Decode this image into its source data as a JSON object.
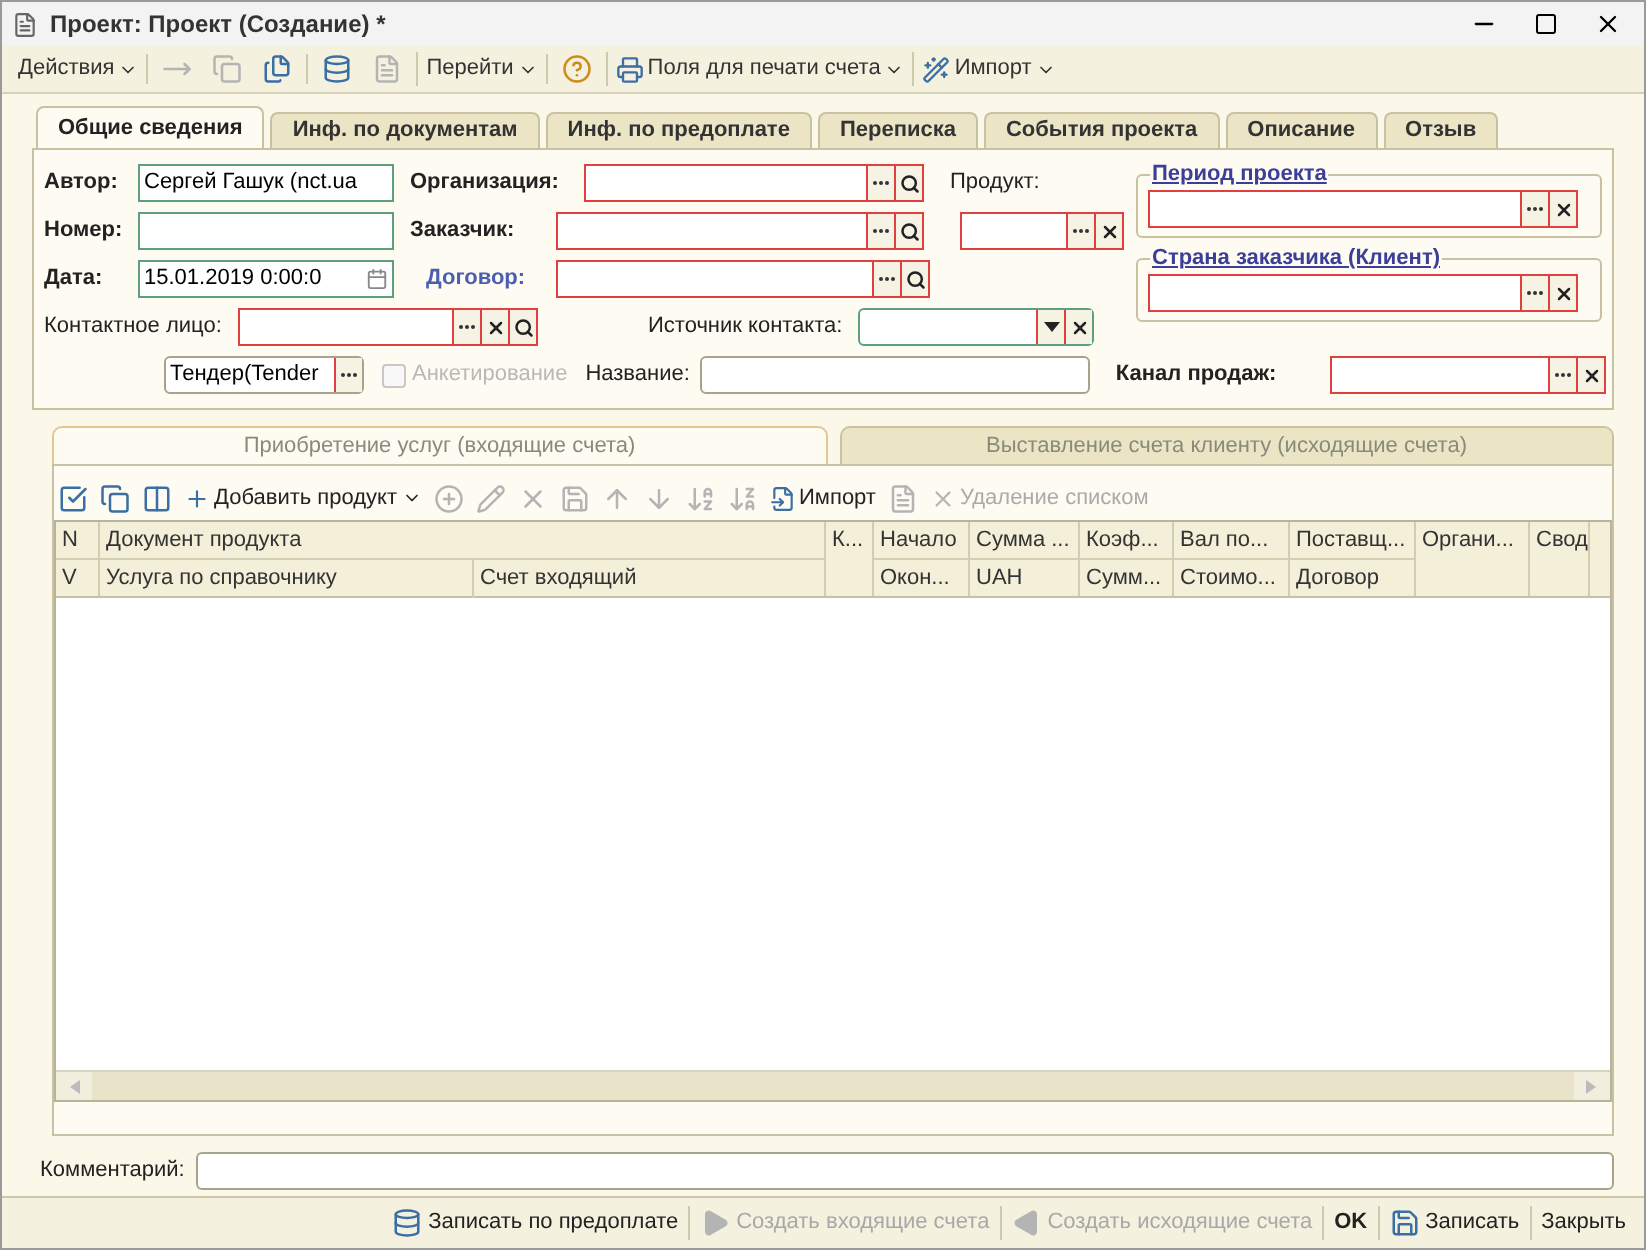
{
  "window": {
    "title": "Проект: Проект (Создание) *"
  },
  "toolbar": [
    [
      {
        "kind": "menu",
        "label": "Действия"
      }
    ],
    [
      {
        "kind": "icon",
        "disabled": true
      },
      {
        "kind": "icon",
        "disabled": true
      },
      {
        "kind": "icon",
        "disabled": false
      }
    ],
    [
      {
        "kind": "icon",
        "disabled": false
      },
      {
        "kind": "icon",
        "disabled": true
      }
    ],
    [
      {
        "kind": "menu",
        "label": "Перейти"
      }
    ],
    [
      {
        "kind": "icon",
        "disabled": false
      }
    ],
    [
      {
        "kind": "menu",
        "label": "Поля для печати счета"
      }
    ],
    [
      {
        "kind": "menu",
        "label": "Импорт"
      }
    ]
  ],
  "tabs": [
    {
      "label": "Общие сведения",
      "selected": true
    },
    {
      "label": "Инф. по документам",
      "selected": false
    },
    {
      "label": "Инф. по предоплате",
      "selected": false
    },
    {
      "label": "Переписка",
      "selected": false
    },
    {
      "label": "События проекта",
      "selected": false
    },
    {
      "label": "Описание",
      "selected": false
    },
    {
      "label": "Отзыв",
      "selected": false
    }
  ],
  "form": {
    "author": {
      "label": "Автор:",
      "value": "Сергей Гашук (nct.ua",
      "required": false
    },
    "number": {
      "label": "Номер:",
      "required": false
    },
    "date": {
      "label": "Дата:",
      "value": "15.01.2019  0:00:0",
      "required": false
    },
    "organization": {
      "label": "Организация:",
      "required": true
    },
    "customer": {
      "label": "Заказчик:",
      "required": true
    },
    "contract": {
      "label": "Договор:",
      "required": true
    },
    "product": {
      "label": "Продукт:",
      "required": true
    },
    "contact_person": {
      "label": "Контактное лицо:",
      "required": true
    },
    "contact_source": {
      "label": "Источник контакта:",
      "required": false
    },
    "tender": {
      "value": "Тендер(Tender"
    },
    "questionnaire": {
      "label": "Анкетирование",
      "checked": false,
      "disabled": true
    },
    "name": {
      "label": "Название:"
    },
    "sales_channel": {
      "label": "Канал продаж:",
      "required": true
    },
    "project_period": {
      "label": "Период проекта",
      "required": true
    },
    "customer_country": {
      "label": "Страна заказчика (Клиент)",
      "required": true
    }
  },
  "subtabs": [
    {
      "label": "Приобретение услуг (входящие счета)",
      "selected": true
    },
    {
      "label": "Выставление счета клиенту (исходящие счета)",
      "selected": false
    }
  ],
  "table_toolbar": [
    {
      "disabled": false
    },
    {
      "disabled": false
    },
    {
      "disabled": false
    },
    {
      "label": "Добавить продукт",
      "menu": true,
      "disabled": false
    },
    {
      "disabled": true
    },
    {
      "disabled": true
    },
    {
      "disabled": true
    },
    {
      "disabled": true
    },
    {
      "disabled": true
    },
    {
      "disabled": true
    },
    {
      "disabled": true
    },
    {
      "disabled": true
    },
    {
      "label": "Импорт",
      "disabled": false
    },
    {
      "disabled": true
    },
    {
      "label": "Удаление списком",
      "disabled": true
    }
  ],
  "table": {
    "columns": [
      {
        "top": "N",
        "bottom": "V"
      },
      {
        "top": "Документ продукта",
        "bottom_parts": [
          "Услуга по справочнику",
          "Счет входящий"
        ]
      },
      {
        "top": "К..."
      },
      {
        "top": "Начало",
        "bottom": "Окон..."
      },
      {
        "top": "Сумма ...",
        "bottom": "UAH"
      },
      {
        "top": "Коэф...",
        "bottom": "Сумм..."
      },
      {
        "top": "Вал по...",
        "bottom": "Стоимо..."
      },
      {
        "top": "Поставщ...",
        "bottom": "Договор"
      },
      {
        "top": "Органи..."
      },
      {
        "top": "Свод"
      }
    ]
  },
  "comment": {
    "label": "Комментарий:"
  },
  "bottom_buttons": [
    {
      "label": "Записать по предоплате",
      "disabled": false
    },
    {
      "label": "Создать входящие счета",
      "disabled": true
    },
    {
      "label": "Создать исходящие счета",
      "disabled": true
    },
    {
      "label": "OK",
      "bold": true,
      "disabled": false
    },
    {
      "label": "Записать",
      "disabled": false
    },
    {
      "label": "Закрыть",
      "disabled": false
    }
  ]
}
